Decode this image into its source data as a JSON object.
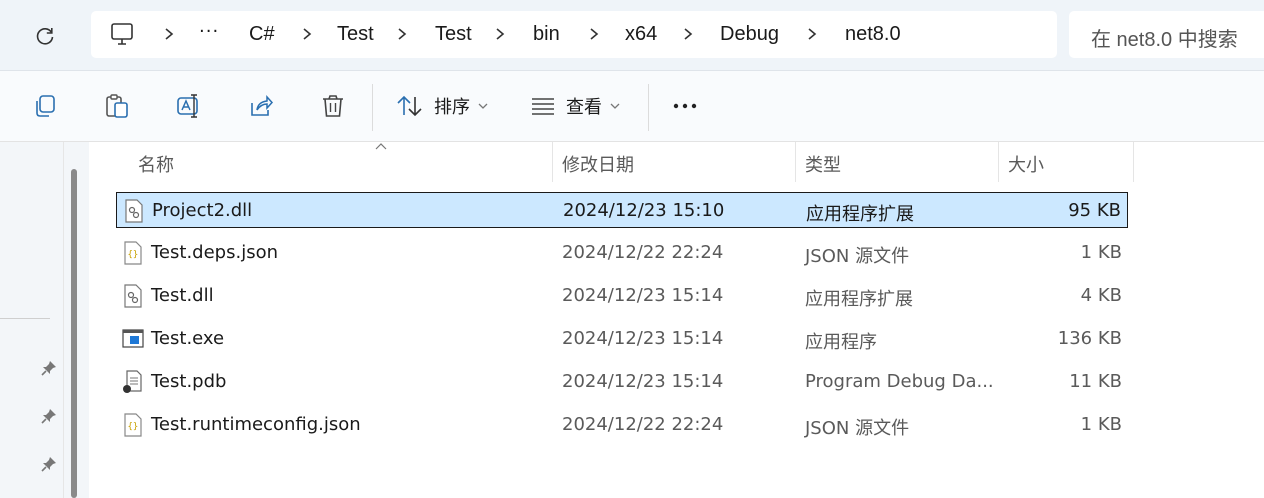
{
  "address": {
    "breadcrumbs": [
      "C#",
      "Test",
      "Test",
      "bin",
      "x64",
      "Debug",
      "net8.0"
    ],
    "overflow": "···",
    "search_placeholder": "在 net8.0 中搜索"
  },
  "toolbar": {
    "sort_label": "排序",
    "view_label": "查看",
    "more": "···",
    "icons": [
      "copy-icon",
      "paste-icon",
      "rename-icon",
      "share-icon",
      "delete-icon",
      "sort-icon",
      "view-icon",
      "more-icon"
    ]
  },
  "columns": {
    "name": "名称",
    "date": "修改日期",
    "type": "类型",
    "size": "大小"
  },
  "files": [
    {
      "name": "Project2.dll",
      "date": "2024/12/23 15:10",
      "type": "应用程序扩展",
      "size": "95 KB",
      "icon": "dll-icon",
      "selected": true
    },
    {
      "name": "Test.deps.json",
      "date": "2024/12/22 22:24",
      "type": "JSON 源文件",
      "size": "1 KB",
      "icon": "json-icon",
      "selected": false
    },
    {
      "name": "Test.dll",
      "date": "2024/12/23 15:14",
      "type": "应用程序扩展",
      "size": "4 KB",
      "icon": "dll-icon",
      "selected": false
    },
    {
      "name": "Test.exe",
      "date": "2024/12/23 15:14",
      "type": "应用程序",
      "size": "136 KB",
      "icon": "exe-icon",
      "selected": false
    },
    {
      "name": "Test.pdb",
      "date": "2024/12/23 15:14",
      "type": "Program Debug Da...",
      "size": "11 KB",
      "icon": "pdb-icon",
      "selected": false
    },
    {
      "name": "Test.runtimeconfig.json",
      "date": "2024/12/22 22:24",
      "type": "JSON 源文件",
      "size": "1 KB",
      "icon": "json-icon",
      "selected": false
    }
  ],
  "colors": {
    "selection": "#cce8ff",
    "chrome": "#eff4f9"
  }
}
